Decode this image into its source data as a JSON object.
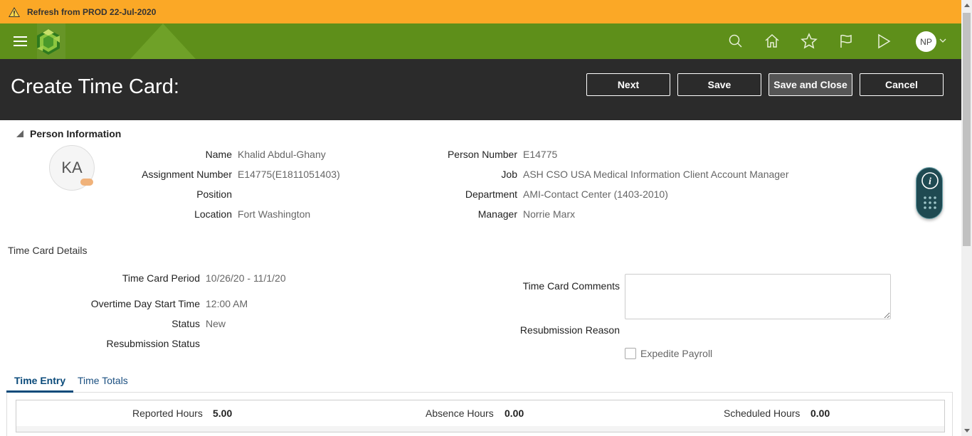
{
  "banner": {
    "text": "Refresh from PROD 22-Jul-2020"
  },
  "header": {
    "title": "Create Time Card:",
    "buttons": {
      "next": "Next",
      "save": "Save",
      "save_close": "Save and Close",
      "cancel": "Cancel"
    }
  },
  "user": {
    "initials": "NP"
  },
  "person_info": {
    "section_title": "Person Information",
    "avatar_initials": "KA",
    "fields": {
      "name_label": "Name",
      "name": "Khalid Abdul-Ghany",
      "assignment_label": "Assignment Number",
      "assignment": "E14775(E1811051403)",
      "position_label": "Position",
      "position": "",
      "location_label": "Location",
      "location": "Fort Washington",
      "person_number_label": "Person Number",
      "person_number": "E14775",
      "job_label": "Job",
      "job": "ASH CSO USA Medical Information Client Account Manager",
      "department_label": "Department",
      "department": "AMI-Contact Center (1403-2010)",
      "manager_label": "Manager",
      "manager": "Norrie Marx"
    }
  },
  "time_card_details": {
    "title": "Time Card Details",
    "period_label": "Time Card Period",
    "period": "10/26/20 - 11/1/20",
    "overtime_label": "Overtime Day Start Time",
    "overtime": "12:00 AM",
    "status_label": "Status",
    "status": "New",
    "resub_status_label": "Resubmission Status",
    "resub_status": "",
    "comments_label": "Time Card Comments",
    "comments": "",
    "resub_reason_label": "Resubmission Reason",
    "expedite_label": "Expedite Payroll"
  },
  "tabs": [
    {
      "label": "Time Entry",
      "active": true
    },
    {
      "label": "Time Totals",
      "active": false
    }
  ],
  "totals": {
    "reported_label": "Reported Hours",
    "reported": "5.00",
    "absence_label": "Absence Hours",
    "absence": "0.00",
    "scheduled_label": "Scheduled Hours",
    "scheduled": "0.00"
  },
  "colors": {
    "banner": "#fba826",
    "topbar": "#5e8f1a",
    "header": "#2b2b2b",
    "accent": "#0a4a7a"
  },
  "icons": [
    "warning-icon",
    "hamburger-icon",
    "logo-icon",
    "search-icon",
    "home-icon",
    "star-icon",
    "flag-icon",
    "send-icon",
    "chevron-down-icon",
    "info-icon",
    "grid-dots-icon"
  ]
}
